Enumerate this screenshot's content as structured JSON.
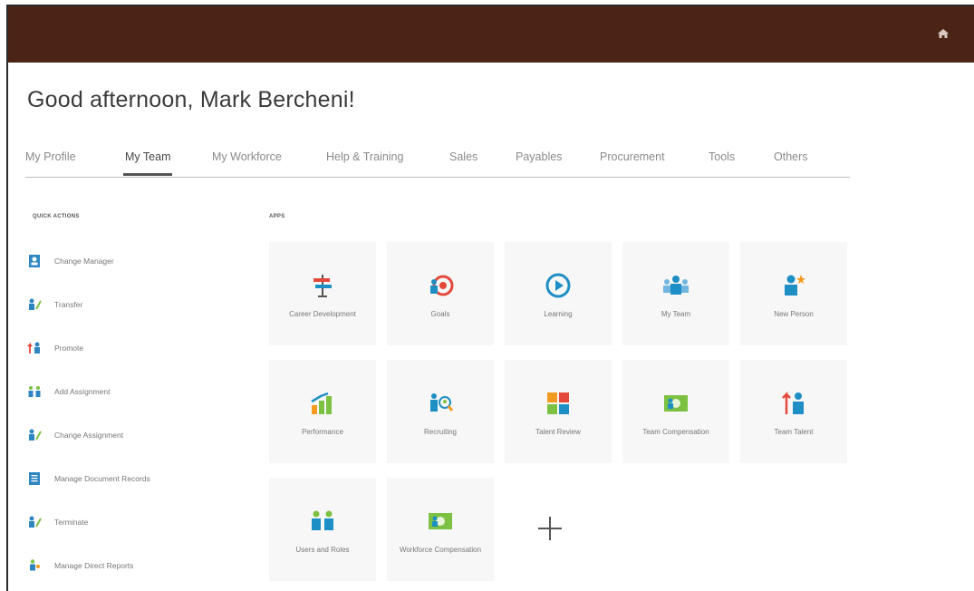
{
  "header": {
    "greeting": "Good afternoon, Mark Bercheni!"
  },
  "tabs": [
    {
      "label": "My Profile",
      "active": false
    },
    {
      "label": "My Team",
      "active": true
    },
    {
      "label": "My Workforce",
      "active": false
    },
    {
      "label": "Help & Training",
      "active": false
    },
    {
      "label": "Sales",
      "active": false
    },
    {
      "label": "Payables",
      "active": false
    },
    {
      "label": "Procurement",
      "active": false
    },
    {
      "label": "Tools",
      "active": false
    },
    {
      "label": "Others",
      "active": false
    }
  ],
  "quick_actions": {
    "title": "QUICK ACTIONS",
    "items": [
      {
        "label": "Change Manager",
        "icon": "person-card-icon"
      },
      {
        "label": "Transfer",
        "icon": "person-transfer-icon"
      },
      {
        "label": "Promote",
        "icon": "promote-icon"
      },
      {
        "label": "Add Assignment",
        "icon": "add-assignment-icon"
      },
      {
        "label": "Change Assignment",
        "icon": "change-assignment-icon"
      },
      {
        "label": "Manage Document Records",
        "icon": "document-icon"
      },
      {
        "label": "Terminate",
        "icon": "terminate-icon"
      },
      {
        "label": "Manage Direct Reports",
        "icon": "direct-reports-icon"
      }
    ]
  },
  "apps": {
    "title": "APPS",
    "tiles": [
      {
        "label": "Career Development",
        "icon": "signpost-icon"
      },
      {
        "label": "Goals",
        "icon": "target-icon"
      },
      {
        "label": "Learning",
        "icon": "play-circle-icon"
      },
      {
        "label": "My Team",
        "icon": "team-icon"
      },
      {
        "label": "New Person",
        "icon": "new-person-icon"
      },
      {
        "label": "Performance",
        "icon": "bar-chart-icon"
      },
      {
        "label": "Recruiting",
        "icon": "recruiting-icon"
      },
      {
        "label": "Talent Review",
        "icon": "talent-grid-icon"
      },
      {
        "label": "Team Compensation",
        "icon": "money-icon"
      },
      {
        "label": "Team Talent",
        "icon": "team-talent-icon"
      },
      {
        "label": "Users and Roles",
        "icon": "users-roles-icon"
      },
      {
        "label": "Workforce Compensation",
        "icon": "money-icon"
      }
    ],
    "add_icon": "plus-icon"
  },
  "colors": {
    "topbar": "#4b2416",
    "teal": "#1e8fc4",
    "green": "#7cc142",
    "orange": "#f39a1f",
    "red": "#e4483a"
  }
}
